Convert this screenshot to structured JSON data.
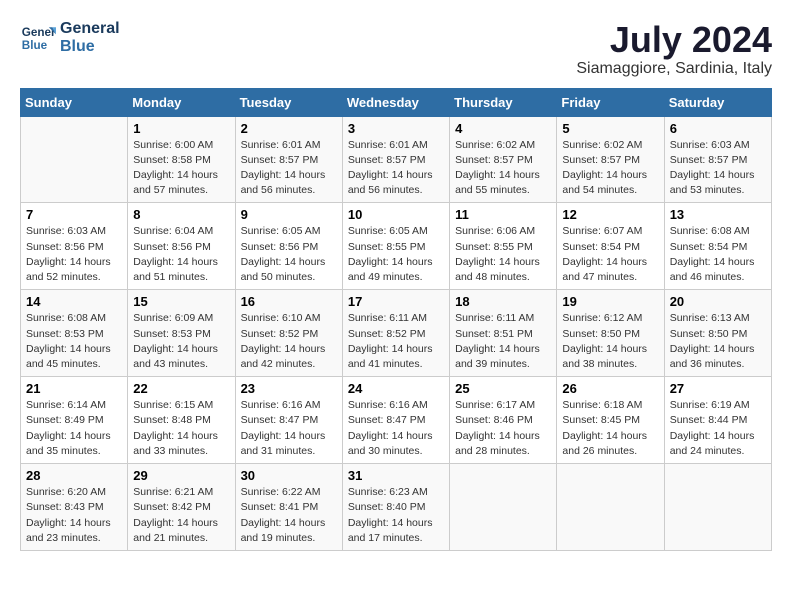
{
  "header": {
    "logo_line1": "General",
    "logo_line2": "Blue",
    "month_year": "July 2024",
    "location": "Siamaggiore, Sardinia, Italy"
  },
  "columns": [
    "Sunday",
    "Monday",
    "Tuesday",
    "Wednesday",
    "Thursday",
    "Friday",
    "Saturday"
  ],
  "weeks": [
    [
      {
        "day": "",
        "info": ""
      },
      {
        "day": "1",
        "info": "Sunrise: 6:00 AM\nSunset: 8:58 PM\nDaylight: 14 hours\nand 57 minutes."
      },
      {
        "day": "2",
        "info": "Sunrise: 6:01 AM\nSunset: 8:57 PM\nDaylight: 14 hours\nand 56 minutes."
      },
      {
        "day": "3",
        "info": "Sunrise: 6:01 AM\nSunset: 8:57 PM\nDaylight: 14 hours\nand 56 minutes."
      },
      {
        "day": "4",
        "info": "Sunrise: 6:02 AM\nSunset: 8:57 PM\nDaylight: 14 hours\nand 55 minutes."
      },
      {
        "day": "5",
        "info": "Sunrise: 6:02 AM\nSunset: 8:57 PM\nDaylight: 14 hours\nand 54 minutes."
      },
      {
        "day": "6",
        "info": "Sunrise: 6:03 AM\nSunset: 8:57 PM\nDaylight: 14 hours\nand 53 minutes."
      }
    ],
    [
      {
        "day": "7",
        "info": "Sunrise: 6:03 AM\nSunset: 8:56 PM\nDaylight: 14 hours\nand 52 minutes."
      },
      {
        "day": "8",
        "info": "Sunrise: 6:04 AM\nSunset: 8:56 PM\nDaylight: 14 hours\nand 51 minutes."
      },
      {
        "day": "9",
        "info": "Sunrise: 6:05 AM\nSunset: 8:56 PM\nDaylight: 14 hours\nand 50 minutes."
      },
      {
        "day": "10",
        "info": "Sunrise: 6:05 AM\nSunset: 8:55 PM\nDaylight: 14 hours\nand 49 minutes."
      },
      {
        "day": "11",
        "info": "Sunrise: 6:06 AM\nSunset: 8:55 PM\nDaylight: 14 hours\nand 48 minutes."
      },
      {
        "day": "12",
        "info": "Sunrise: 6:07 AM\nSunset: 8:54 PM\nDaylight: 14 hours\nand 47 minutes."
      },
      {
        "day": "13",
        "info": "Sunrise: 6:08 AM\nSunset: 8:54 PM\nDaylight: 14 hours\nand 46 minutes."
      }
    ],
    [
      {
        "day": "14",
        "info": "Sunrise: 6:08 AM\nSunset: 8:53 PM\nDaylight: 14 hours\nand 45 minutes."
      },
      {
        "day": "15",
        "info": "Sunrise: 6:09 AM\nSunset: 8:53 PM\nDaylight: 14 hours\nand 43 minutes."
      },
      {
        "day": "16",
        "info": "Sunrise: 6:10 AM\nSunset: 8:52 PM\nDaylight: 14 hours\nand 42 minutes."
      },
      {
        "day": "17",
        "info": "Sunrise: 6:11 AM\nSunset: 8:52 PM\nDaylight: 14 hours\nand 41 minutes."
      },
      {
        "day": "18",
        "info": "Sunrise: 6:11 AM\nSunset: 8:51 PM\nDaylight: 14 hours\nand 39 minutes."
      },
      {
        "day": "19",
        "info": "Sunrise: 6:12 AM\nSunset: 8:50 PM\nDaylight: 14 hours\nand 38 minutes."
      },
      {
        "day": "20",
        "info": "Sunrise: 6:13 AM\nSunset: 8:50 PM\nDaylight: 14 hours\nand 36 minutes."
      }
    ],
    [
      {
        "day": "21",
        "info": "Sunrise: 6:14 AM\nSunset: 8:49 PM\nDaylight: 14 hours\nand 35 minutes."
      },
      {
        "day": "22",
        "info": "Sunrise: 6:15 AM\nSunset: 8:48 PM\nDaylight: 14 hours\nand 33 minutes."
      },
      {
        "day": "23",
        "info": "Sunrise: 6:16 AM\nSunset: 8:47 PM\nDaylight: 14 hours\nand 31 minutes."
      },
      {
        "day": "24",
        "info": "Sunrise: 6:16 AM\nSunset: 8:47 PM\nDaylight: 14 hours\nand 30 minutes."
      },
      {
        "day": "25",
        "info": "Sunrise: 6:17 AM\nSunset: 8:46 PM\nDaylight: 14 hours\nand 28 minutes."
      },
      {
        "day": "26",
        "info": "Sunrise: 6:18 AM\nSunset: 8:45 PM\nDaylight: 14 hours\nand 26 minutes."
      },
      {
        "day": "27",
        "info": "Sunrise: 6:19 AM\nSunset: 8:44 PM\nDaylight: 14 hours\nand 24 minutes."
      }
    ],
    [
      {
        "day": "28",
        "info": "Sunrise: 6:20 AM\nSunset: 8:43 PM\nDaylight: 14 hours\nand 23 minutes."
      },
      {
        "day": "29",
        "info": "Sunrise: 6:21 AM\nSunset: 8:42 PM\nDaylight: 14 hours\nand 21 minutes."
      },
      {
        "day": "30",
        "info": "Sunrise: 6:22 AM\nSunset: 8:41 PM\nDaylight: 14 hours\nand 19 minutes."
      },
      {
        "day": "31",
        "info": "Sunrise: 6:23 AM\nSunset: 8:40 PM\nDaylight: 14 hours\nand 17 minutes."
      },
      {
        "day": "",
        "info": ""
      },
      {
        "day": "",
        "info": ""
      },
      {
        "day": "",
        "info": ""
      }
    ]
  ]
}
